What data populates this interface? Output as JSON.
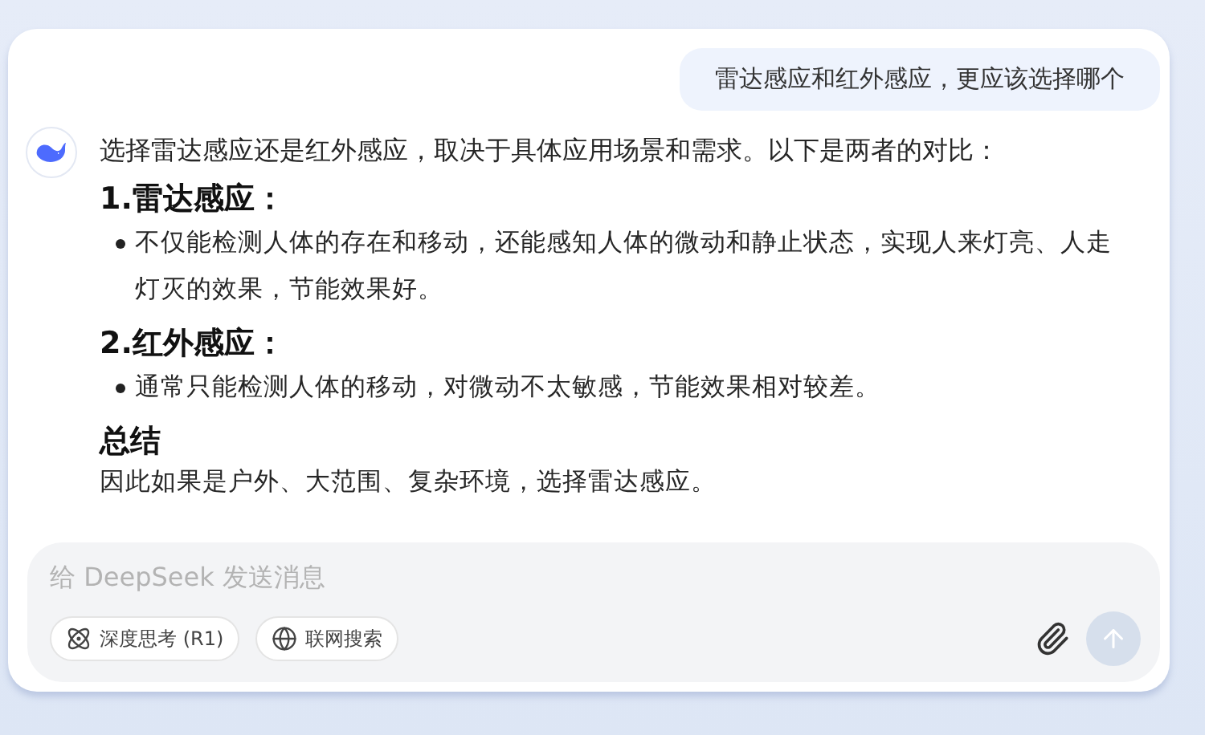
{
  "user_message": {
    "text": "雷达感应和红外感应，更应该选择哪个"
  },
  "reply": {
    "intro": "选择雷达感应还是红外感应，取决于具体应用场景和需求。以下是两者的对比：",
    "sections": [
      {
        "kind": "bullets",
        "heading": "1.雷达感应：",
        "bullets": [
          "不仅能检测人体的存在和移动，还能感知人体的微动和静止状态，实现人来灯亮、人走灯灭的效果，节能效果好。"
        ]
      },
      {
        "kind": "bullets",
        "heading": "2.红外感应：",
        "bullets": [
          "通常只能检测人体的移动，对微动不太敏感，节能效果相对较差。"
        ]
      },
      {
        "kind": "paragraph",
        "heading": "总结",
        "text": "因此如果是户外、大范围、复杂环境，选择雷达感应。"
      }
    ]
  },
  "composer": {
    "placeholder": "给 DeepSeek 发送消息",
    "toggles": [
      {
        "kind": "think",
        "label": "深度思考 (R1)",
        "on": false
      },
      {
        "kind": "search",
        "label": "联网搜索",
        "on": false
      }
    ],
    "send": {
      "disabled": true
    }
  }
}
